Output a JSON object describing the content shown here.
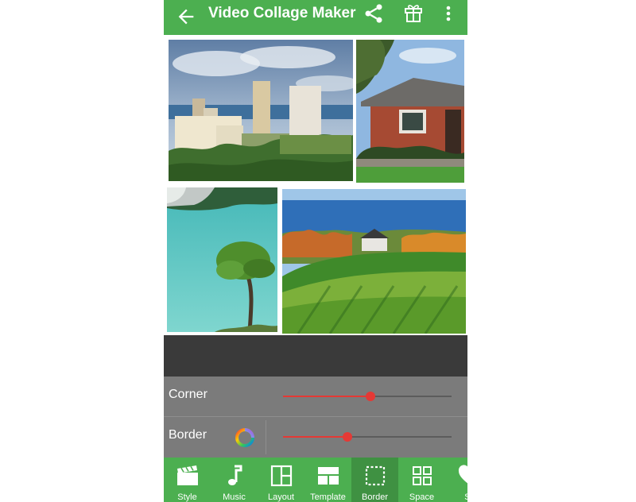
{
  "app_bar": {
    "title": "Video Collage Maker",
    "icons": [
      "back-arrow-icon",
      "share-icon",
      "gift-icon",
      "more-vert-icon"
    ]
  },
  "sliders": {
    "corner": {
      "label": "Corner",
      "level": 0.52
    },
    "border": {
      "label": "Border",
      "level": 0.38
    }
  },
  "bottom_nav": {
    "items": [
      {
        "label": "Style",
        "icon": "clapperboard-icon"
      },
      {
        "label": "Music",
        "icon": "music-note-icon"
      },
      {
        "label": "Layout",
        "icon": "layout-grid-icon"
      },
      {
        "label": "Template",
        "icon": "template-icon"
      },
      {
        "label": "Border",
        "icon": "border-dashed-icon",
        "active": true
      },
      {
        "label": "Space",
        "icon": "space-grid-icon"
      },
      {
        "label": "St",
        "icon": "sticker-icon"
      }
    ]
  },
  "colors": {
    "primary": "#4caf50",
    "primary_dark": "#3f9142",
    "slider_accent": "#e53935",
    "panel_bg": "#7b7b7b",
    "band_bg": "#3a3a3a"
  }
}
